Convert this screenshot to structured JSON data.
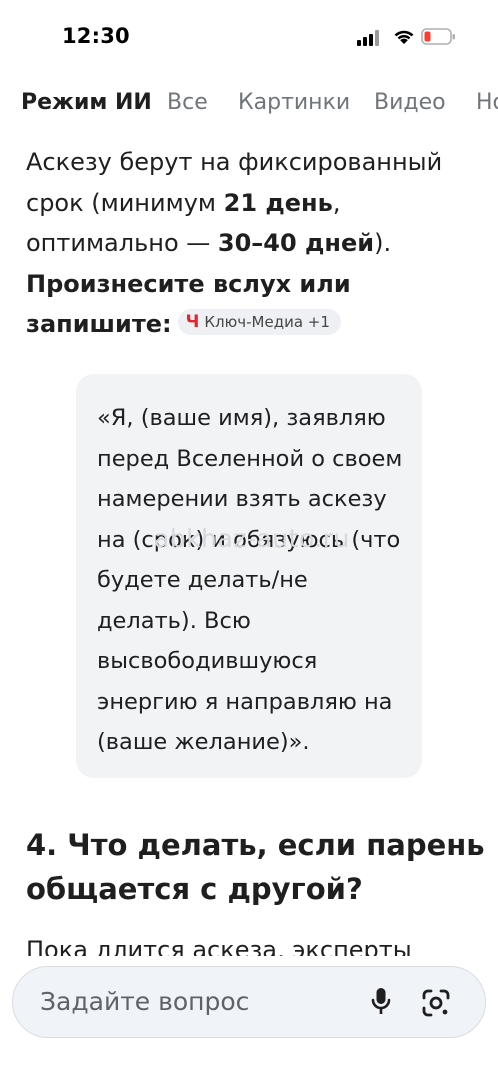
{
  "status_bar": {
    "time": "12:30"
  },
  "tabs": [
    {
      "label": "Режим ИИ",
      "active": true
    },
    {
      "label": "Все"
    },
    {
      "label": "Картинки"
    },
    {
      "label": "Видео"
    },
    {
      "label": "Но"
    }
  ],
  "answer": {
    "p1_a": "Аскезу берут на фиксированный срок (минимум ",
    "p1_b": "21 день",
    "p1_c": ", оптимально — ",
    "p1_d": "30–40 дней",
    "p1_e": "). ",
    "p1_f": "Произнесите вслух или запишите:",
    "source_chip": {
      "logo": "Ч",
      "label": "Ключ-Медиа +1"
    },
    "quote": "«Я, (ваше имя), заявляю перед Вселенной о своем намерении взять аскезу на (срок) и обязуюсь (что будете делать/не делать). Всю высвободившуюся энергию я направляю на (ваше желание)».",
    "watermark": "abkhaz-auto.ru",
    "heading": "4. Что делать, если парень общается с другой?",
    "next_line": "Пока длится аскеза, эксперты"
  },
  "ask_bar": {
    "placeholder": "Задайте вопрос"
  },
  "colors": {
    "accent_red": "#e3262b",
    "muted": "#70757a",
    "card_bg": "#f1f3f5"
  }
}
